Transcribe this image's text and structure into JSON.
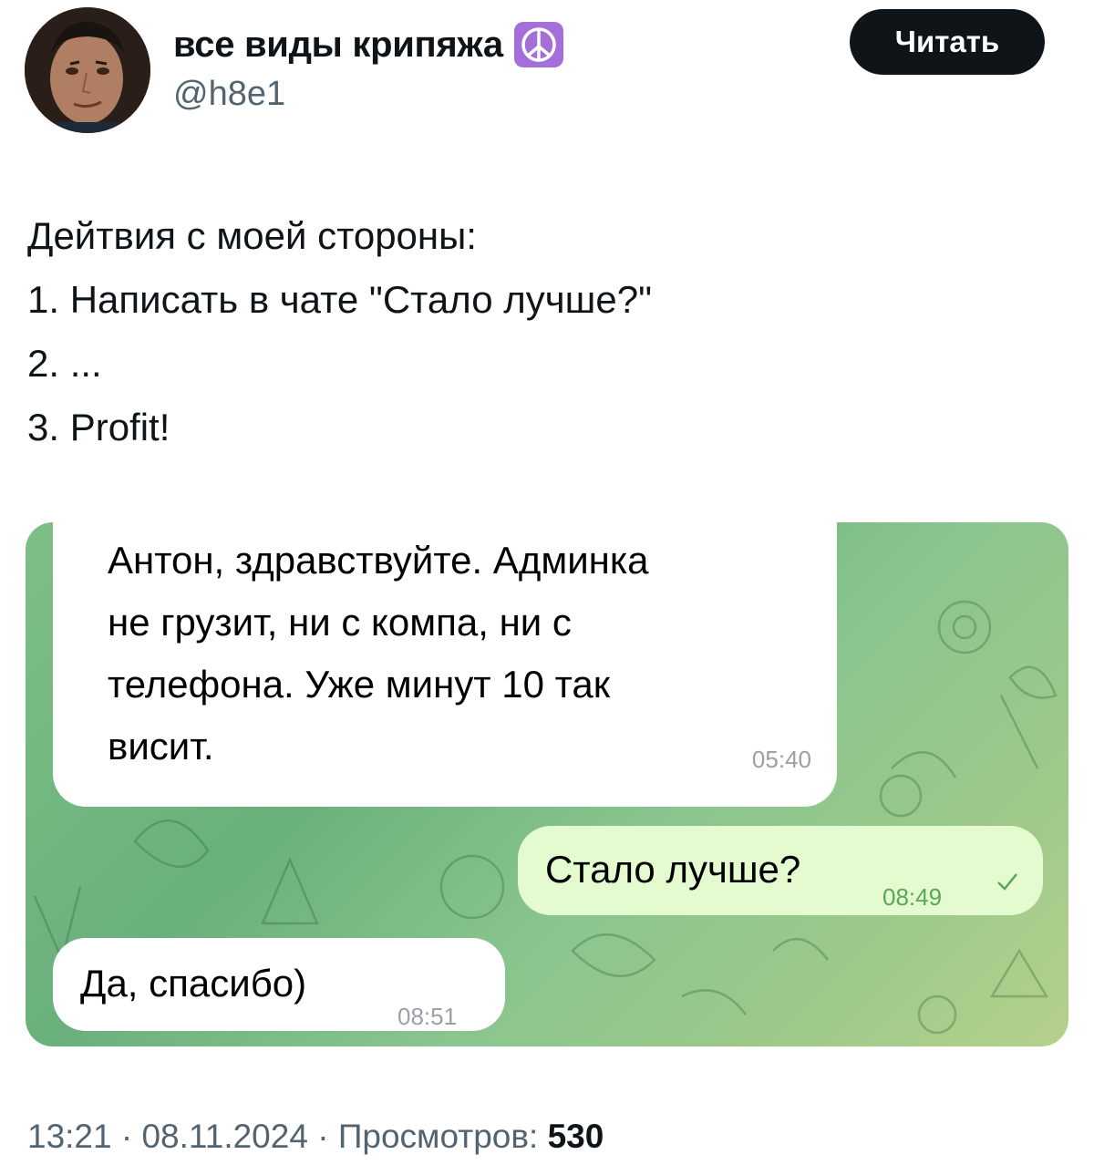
{
  "author": {
    "display_name": "все виды крипяжа",
    "handle": "@h8e1",
    "badge_icon": "peace-symbol-icon",
    "badge_color": "#a56fd9"
  },
  "follow_button": {
    "label": "Читать"
  },
  "tweet": {
    "lines": [
      "Дейтвия с моей стороны:",
      "1. Написать в чате \"Стало лучше?\"",
      "2. ...",
      "3. Profit!"
    ]
  },
  "chat": {
    "messages": [
      {
        "direction": "incoming",
        "lines": [
          "Антон, здравствуйте. Админка",
          "не грузит, ни с компа, ни с",
          "телефона. Уже минут 10 так",
          "висит."
        ],
        "time": "05:40"
      },
      {
        "direction": "outgoing",
        "text": "Стало лучше?",
        "time": "08:49",
        "status_icon": "single-check-icon"
      },
      {
        "direction": "incoming",
        "text": "Да, спасибо)",
        "time": "08:51"
      }
    ],
    "colors": {
      "incoming_bubble": "#ffffff",
      "outgoing_bubble": "#e4fbd0",
      "background": "#7dbf86"
    }
  },
  "footer": {
    "time": "13:21",
    "date": "08.11.2024",
    "views_label": "Просмотров:",
    "views_count": "530"
  }
}
